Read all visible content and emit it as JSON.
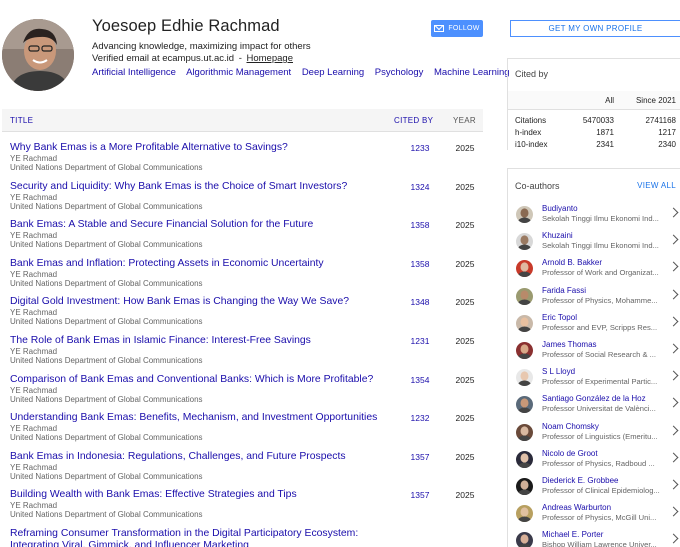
{
  "profile": {
    "name": "Yoesoep Edhie Rachmad",
    "affiliation": "Advancing knowledge, maximizing impact for others",
    "email_text": "Verified email at ecampus.ut.ac.id",
    "email_sep": "-",
    "homepage_label": "Homepage",
    "interests": [
      "Artificial Intelligence",
      "Algorithmic Management",
      "Deep Learning",
      "Psychology",
      "Machine Learning"
    ],
    "follow_label": "FOLLOW"
  },
  "table": {
    "col_title": "TITLE",
    "col_cited": "CITED BY",
    "col_year": "YEAR",
    "rows": [
      {
        "title": "Why Bank Emas is a More Profitable Alternative to Savings?",
        "authors": "YE Rachmad",
        "venue": "United Nations Department of Global Communications",
        "cited": "1233",
        "year": "2025"
      },
      {
        "title": "Security and Liquidity: Why Bank Emas is the Choice of Smart Investors?",
        "authors": "YE Rachmad",
        "venue": "United Nations Department of Global Communications",
        "cited": "1324",
        "year": "2025"
      },
      {
        "title": "Bank Emas: A Stable and Secure Financial Solution for the Future",
        "authors": "YE Rachmad",
        "venue": "United Nations Department of Global Communications",
        "cited": "1358",
        "year": "2025"
      },
      {
        "title": "Bank Emas and Inflation: Protecting Assets in Economic Uncertainty",
        "authors": "YE Rachmad",
        "venue": "United Nations Department of Global Communications",
        "cited": "1358",
        "year": "2025"
      },
      {
        "title": "Digital Gold Investment: How Bank Emas is Changing the Way We Save?",
        "authors": "YE Rachmad",
        "venue": "United Nations Department of Global Communications",
        "cited": "1348",
        "year": "2025"
      },
      {
        "title": "The Role of Bank Emas in Islamic Finance: Interest-Free Savings",
        "authors": "YE Rachmad",
        "venue": "United Nations Department of Global Communications",
        "cited": "1231",
        "year": "2025"
      },
      {
        "title": "Comparison of Bank Emas and Conventional Banks: Which is More Profitable?",
        "authors": "YE Rachmad",
        "venue": "United Nations Department of Global Communications",
        "cited": "1354",
        "year": "2025"
      },
      {
        "title": "Understanding Bank Emas: Benefits, Mechanism, and Investment Opportunities",
        "authors": "YE Rachmad",
        "venue": "United Nations Department of Global Communications",
        "cited": "1232",
        "year": "2025"
      },
      {
        "title": "Bank Emas in Indonesia: Regulations, Challenges, and Future Prospects",
        "authors": "YE Rachmad",
        "venue": "United Nations Department of Global Communications",
        "cited": "1357",
        "year": "2025"
      },
      {
        "title": "Building Wealth with Bank Emas: Effective Strategies and Tips",
        "authors": "YE Rachmad",
        "venue": "United Nations Department of Global Communications",
        "cited": "1357",
        "year": "2025"
      },
      {
        "title": "Reframing Consumer Transformation in the Digital Participatory Ecosystem: Integrating Viral, Gimmick, and Influencer Marketing",
        "authors": "",
        "venue": "",
        "cited": "",
        "year": ""
      }
    ]
  },
  "right": {
    "get_profile_label": "GET MY OWN PROFILE",
    "cited_by_title": "Cited by",
    "cited_cols": [
      "All",
      "Since 2021"
    ],
    "cited_rows": [
      {
        "label": "Citations",
        "all": "5470033",
        "since": "2741168"
      },
      {
        "label": "h-index",
        "all": "1871",
        "since": "1217"
      },
      {
        "label": "i10-index",
        "all": "2341",
        "since": "2340"
      }
    ],
    "coauthors_title": "Co-authors",
    "view_all_label": "VIEW ALL",
    "coauthors": [
      {
        "name": "Budiyanto",
        "affil": "Sekolah Tinggi Ilmu Ekonomi Ind...",
        "skin": "#8a6a52",
        "bg": "#cfc7b8"
      },
      {
        "name": "Khuzaini",
        "affil": "Sekolah Tinggi Ilmu Ekonomi Ind...",
        "skin": "#9a7a62",
        "bg": "#d8d8d8"
      },
      {
        "name": "Arnold B. Bakker",
        "affil": "Professor of Work and Organizat...",
        "skin": "#e0b8a0",
        "bg": "#c83a2a"
      },
      {
        "name": "Farida Fassi",
        "affil": "Professor of Physics, Mohamme...",
        "skin": "#b88a6a",
        "bg": "#9a9a70"
      },
      {
        "name": "Eric Topol",
        "affil": "Professor and EVP, Scripps Res...",
        "skin": "#e8c0a0",
        "bg": "#c9b9a9"
      },
      {
        "name": "James Thomas",
        "affil": "Professor of Social Research & ...",
        "skin": "#d8a888",
        "bg": "#8a3030"
      },
      {
        "name": "S L Lloyd",
        "affil": "Professor of Experimental Partic...",
        "skin": "#e8c8b0",
        "bg": "#e8e8e8"
      },
      {
        "name": "Santiago González de la Hoz",
        "affil": "Professor Universitat de Valènci...",
        "skin": "#c89878",
        "bg": "#5a6a7a"
      },
      {
        "name": "Noam Chomsky",
        "affil": "Professor of Linguistics (Emeritu...",
        "skin": "#d8b8a0",
        "bg": "#6a4a3a"
      },
      {
        "name": "Nicolo de Groot",
        "affil": "Professor of Physics, Radboud ...",
        "skin": "#e0c0a8",
        "bg": "#2a2a3a"
      },
      {
        "name": "Diederick E. Grobbee",
        "affil": "Professor of Clinical Epidemiolog...",
        "skin": "#d0b098",
        "bg": "#1a1a1a"
      },
      {
        "name": "Andreas Warburton",
        "affil": "Professor of Physics, McGill Uni...",
        "skin": "#e0c0a0",
        "bg": "#b8a060"
      },
      {
        "name": "Michael E. Porter",
        "affil": "Bishop William Lawrence Univer...",
        "skin": "#d8b098",
        "bg": "#3a3a4a"
      }
    ]
  }
}
